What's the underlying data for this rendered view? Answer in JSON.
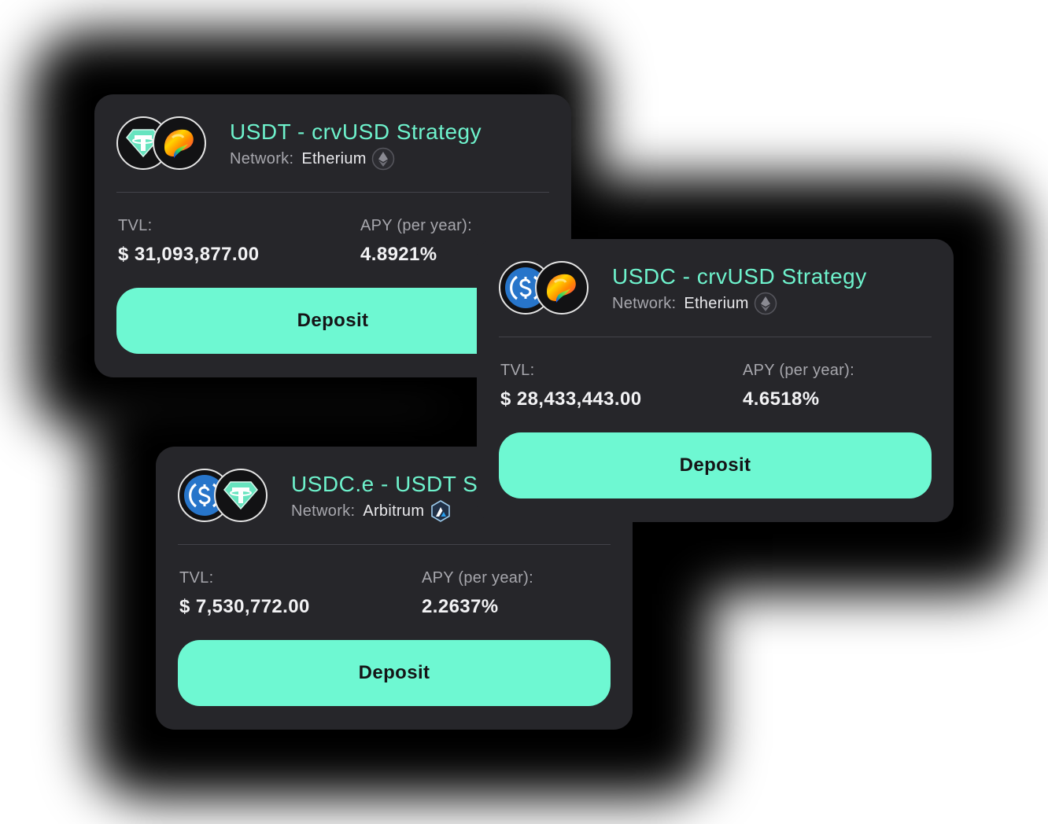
{
  "cards": [
    {
      "title": "USDT - crvUSD Strategy",
      "network_label": "Network:",
      "network": "Etherium",
      "tvl_label": "TVL:",
      "tvl": "$ 31,093,877.00",
      "apy_label": "APY (per year):",
      "apy": "4.8921%",
      "deposit_label": "Deposit",
      "tokens": [
        "usdt-icon",
        "curve-icon"
      ],
      "network_icon": "ethereum-icon"
    },
    {
      "title": "USDC - crvUSD Strategy",
      "network_label": "Network:",
      "network": "Etherium",
      "tvl_label": "TVL:",
      "tvl": "$ 28,433,443.00",
      "apy_label": "APY (per year):",
      "apy": "4.6518%",
      "deposit_label": "Deposit",
      "tokens": [
        "usdc-icon",
        "curve-icon"
      ],
      "network_icon": "ethereum-icon"
    },
    {
      "title": "USDC.e - USDT S",
      "network_label": "Network:",
      "network": "Arbitrum",
      "tvl_label": "TVL:",
      "tvl": "$ 7,530,772.00",
      "apy_label": "APY (per year):",
      "apy": "2.2637%",
      "deposit_label": "Deposit",
      "tokens": [
        "usdc-icon",
        "usdt-icon"
      ],
      "network_icon": "arbitrum-icon"
    }
  ],
  "colors": {
    "card_bg": "#26262a",
    "accent": "#6ef2cc",
    "button_bg": "#6ef8d2",
    "label": "#a7a7ad"
  }
}
